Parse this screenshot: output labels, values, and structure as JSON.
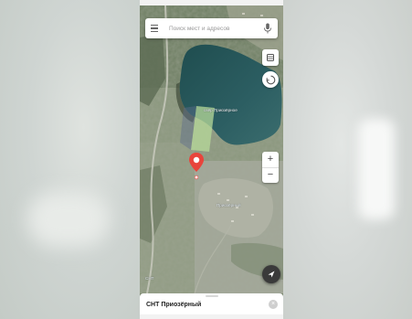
{
  "search": {
    "placeholder": "Поиск мест и адресов"
  },
  "map": {
    "water_label": "озёр Приозёрное",
    "place_label_1": "Приозёрный",
    "place_label_2": "СНТ",
    "accent_color": "#e8453c"
  },
  "controls": {
    "zoom_in": "+",
    "zoom_out": "−",
    "icons": [
      "menu-icon",
      "microphone-icon",
      "layers-icon",
      "compass-icon",
      "navigation-arrow-icon",
      "location-pin-icon",
      "close-icon"
    ]
  },
  "sheet": {
    "title": "СНТ Приозёрный",
    "close": "×"
  }
}
